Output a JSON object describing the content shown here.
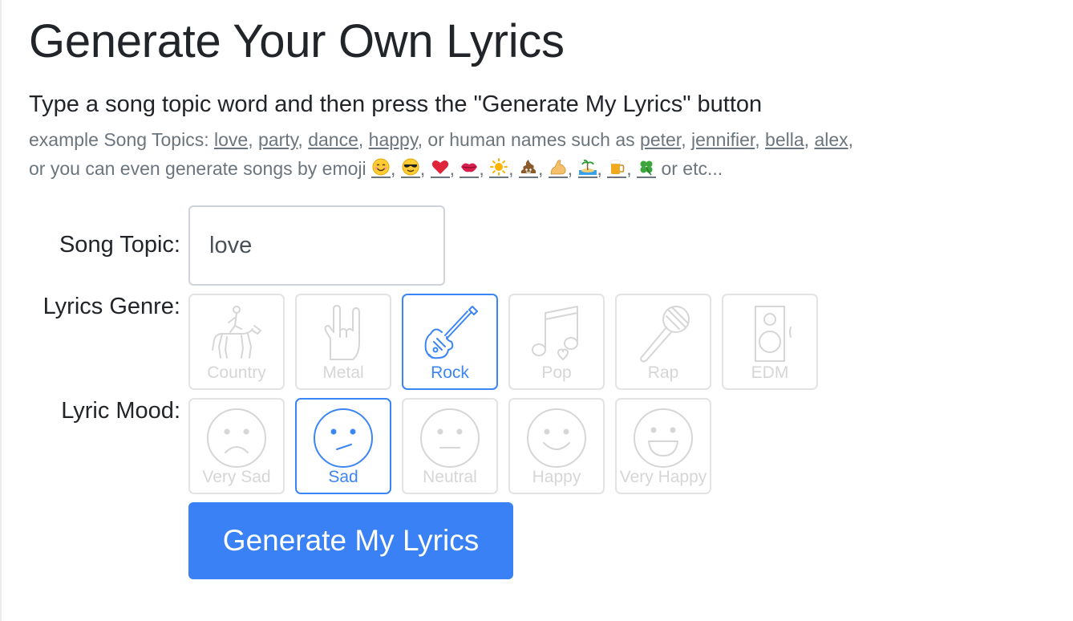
{
  "header": {
    "title": "Generate Your Own Lyrics",
    "instruction": "Type a song topic word and then press the \"Generate My Lyrics\" button"
  },
  "examples": {
    "prefix": "example Song Topics: ",
    "topics": [
      "love",
      "party",
      "dance",
      "happy"
    ],
    "names_intro": "or human names such as ",
    "names": [
      "peter",
      "jennifier",
      "bella",
      "alex"
    ],
    "emoji_intro": "or you can even generate songs by emoji ",
    "emojis": [
      "smiling-face-icon",
      "sunglasses-face-icon",
      "red-heart-icon",
      "kiss-lips-icon",
      "sun-icon",
      "poop-icon",
      "flexed-arm-icon",
      "island-icon",
      "beer-mug-icon",
      "four-leaf-clover-icon"
    ],
    "suffix": " or etc..."
  },
  "form": {
    "topic_label": "Song Topic:",
    "topic_value": "love",
    "genre_label": "Lyrics Genre:",
    "mood_label": "Lyric Mood:",
    "genres": [
      {
        "label": "Country",
        "icon": "horse-rider-icon",
        "selected": false
      },
      {
        "label": "Metal",
        "icon": "rock-hand-icon",
        "selected": false
      },
      {
        "label": "Rock",
        "icon": "electric-guitar-icon",
        "selected": true
      },
      {
        "label": "Pop",
        "icon": "music-note-icon",
        "selected": false
      },
      {
        "label": "Rap",
        "icon": "microphone-icon",
        "selected": false
      },
      {
        "label": "EDM",
        "icon": "speaker-icon",
        "selected": false
      }
    ],
    "moods": [
      {
        "label": "Very Sad",
        "icon": "very-sad-face-icon",
        "selected": false
      },
      {
        "label": "Sad",
        "icon": "sad-face-icon",
        "selected": true
      },
      {
        "label": "Neutral",
        "icon": "neutral-face-icon",
        "selected": false
      },
      {
        "label": "Happy",
        "icon": "happy-face-icon",
        "selected": false
      },
      {
        "label": "Very Happy",
        "icon": "very-happy-face-icon",
        "selected": false
      }
    ],
    "submit_label": "Generate My Lyrics"
  },
  "colors": {
    "accent": "#3a81f5",
    "tile_border": "#e3e3e3",
    "muted_text": "#6c757d"
  }
}
